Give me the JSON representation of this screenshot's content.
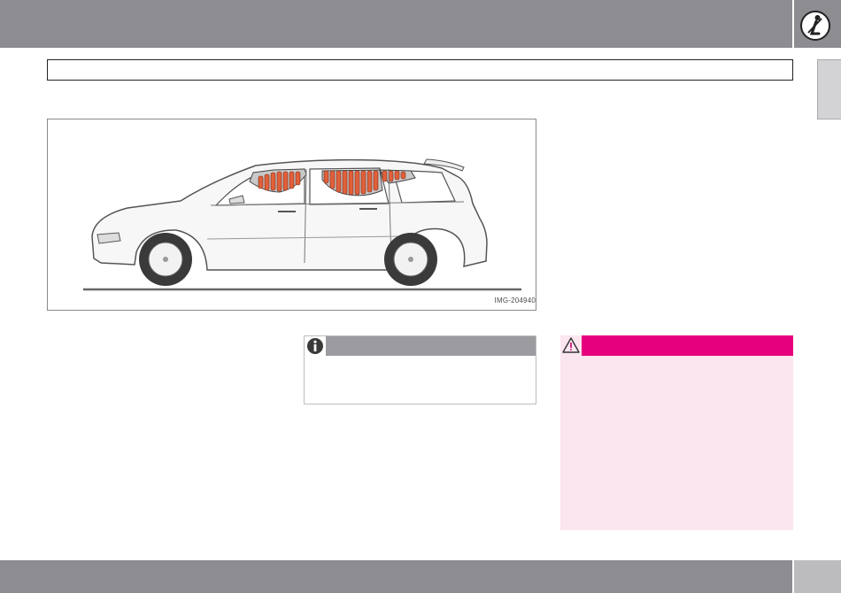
{
  "header": {
    "safety_icon": "seat-belt-safety-icon"
  },
  "section_heading": "",
  "figure": {
    "image_code": "IMG-204940",
    "illustration": "car-side-view-inflatable-curtain",
    "colors": {
      "curtain": "#e0603a",
      "outline": "#555555"
    }
  },
  "note": {
    "icon": "info-icon",
    "title": ""
  },
  "warning": {
    "icon": "warning-triangle-icon",
    "title": "",
    "colors": {
      "header": "#e6007e",
      "body": "#fbe5ee"
    }
  },
  "footer": {
    "page_number": ""
  }
}
